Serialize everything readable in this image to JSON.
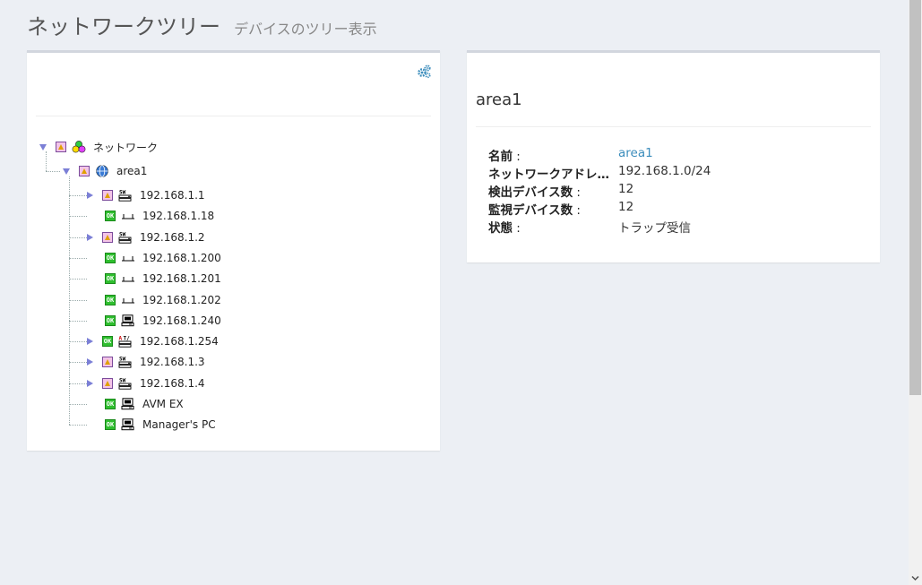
{
  "header": {
    "title": "ネットワークツリー",
    "subtitle": "デバイスのツリー表示"
  },
  "tree": {
    "root": {
      "label": "ネットワーク",
      "status": "warn",
      "icon": "network-group-icon",
      "expanded": true
    },
    "area": {
      "label": "area1",
      "status": "warn",
      "icon": "area-globe-icon",
      "expanded": true
    },
    "nodes": [
      {
        "label": "192.168.1.1",
        "status": "warn",
        "icon": "switch-icon",
        "expandable": true
      },
      {
        "label": "192.168.1.18",
        "status": "ok",
        "icon": "host-icon",
        "expandable": false
      },
      {
        "label": "192.168.1.2",
        "status": "warn",
        "icon": "switch-icon",
        "expandable": true
      },
      {
        "label": "192.168.1.200",
        "status": "ok",
        "icon": "host-icon",
        "expandable": false
      },
      {
        "label": "192.168.1.201",
        "status": "ok",
        "icon": "host-icon",
        "expandable": false
      },
      {
        "label": "192.168.1.202",
        "status": "ok",
        "icon": "host-icon",
        "expandable": false
      },
      {
        "label": "192.168.1.240",
        "status": "ok",
        "icon": "pc-icon",
        "expandable": false
      },
      {
        "label": "192.168.1.254",
        "status": "ok",
        "icon": "router-icon",
        "expandable": true
      },
      {
        "label": "192.168.1.3",
        "status": "warn",
        "icon": "switch-icon",
        "expandable": true
      },
      {
        "label": "192.168.1.4",
        "status": "warn",
        "icon": "switch-icon",
        "expandable": true
      },
      {
        "label": "AVM EX",
        "status": "ok",
        "icon": "pc-icon",
        "expandable": false
      },
      {
        "label": "Manager's PC",
        "status": "ok",
        "icon": "pc-icon",
        "expandable": false
      }
    ]
  },
  "detail": {
    "title": "area1",
    "rows": [
      {
        "key": "名前",
        "value": "area1",
        "link": true
      },
      {
        "key": "ネットワークアドレス",
        "value": "192.168.1.0/24",
        "link": false
      },
      {
        "key": "検出デバイス数",
        "value": "12",
        "link": false
      },
      {
        "key": "監視デバイス数",
        "value": "12",
        "link": false
      },
      {
        "key": "状態",
        "value": "トラップ受信",
        "link": false
      }
    ]
  },
  "status_labels": {
    "ok": "OK"
  },
  "colors": {
    "accent": "#3c8dbc",
    "toggle": "#7b7fd6",
    "ok": "#2fbf2f",
    "warn": "#f3c4e8"
  }
}
